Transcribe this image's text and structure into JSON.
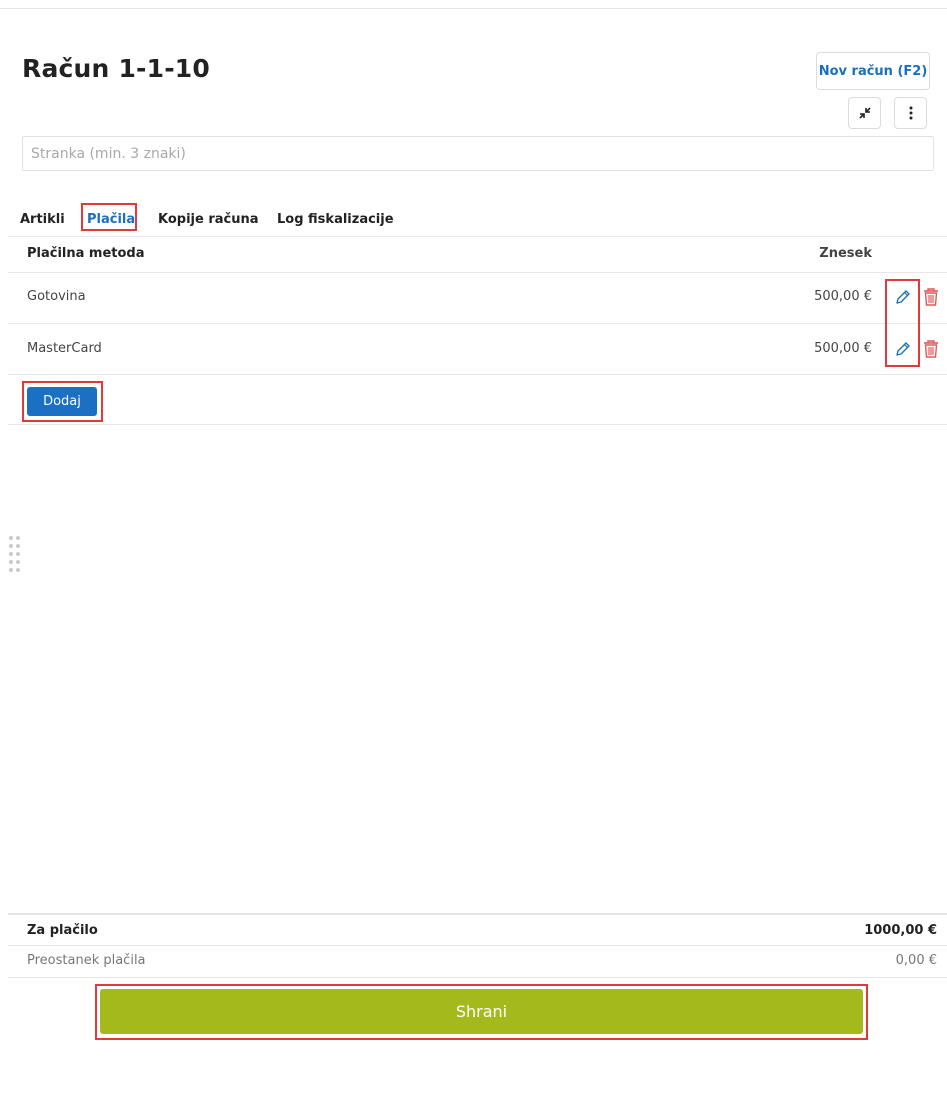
{
  "header": {
    "title": "Račun 1-1-10",
    "new_invoice_label": "Nov račun (F2)"
  },
  "client": {
    "placeholder": "Stranka (min. 3 znaki)",
    "value": ""
  },
  "tabs": [
    {
      "label": "Artikli",
      "active": false
    },
    {
      "label": "Plačila",
      "active": true
    },
    {
      "label": "Kopije računa",
      "active": false
    },
    {
      "label": "Log fiskalizacije",
      "active": false
    }
  ],
  "payments": {
    "headers": {
      "method": "Plačilna metoda",
      "amount": "Znesek"
    },
    "rows": [
      {
        "method": "Gotovina",
        "amount": "500,00 €"
      },
      {
        "method": "MasterCard",
        "amount": "500,00 €"
      }
    ],
    "add_label": "Dodaj"
  },
  "summary": {
    "total_label": "Za plačilo",
    "total_value": "1000,00 €",
    "remaining_label": "Preostanek plačila",
    "remaining_value": "0,00 €"
  },
  "save_label": "Shrani",
  "colors": {
    "accent": "#1a70c2",
    "save": "#a3b91c",
    "delete": "#e05a5a",
    "highlight": "#e03a3a"
  },
  "icons": [
    "collapse-icon",
    "more-vertical-icon",
    "pencil-icon",
    "trash-icon",
    "drag-handle-icon"
  ]
}
